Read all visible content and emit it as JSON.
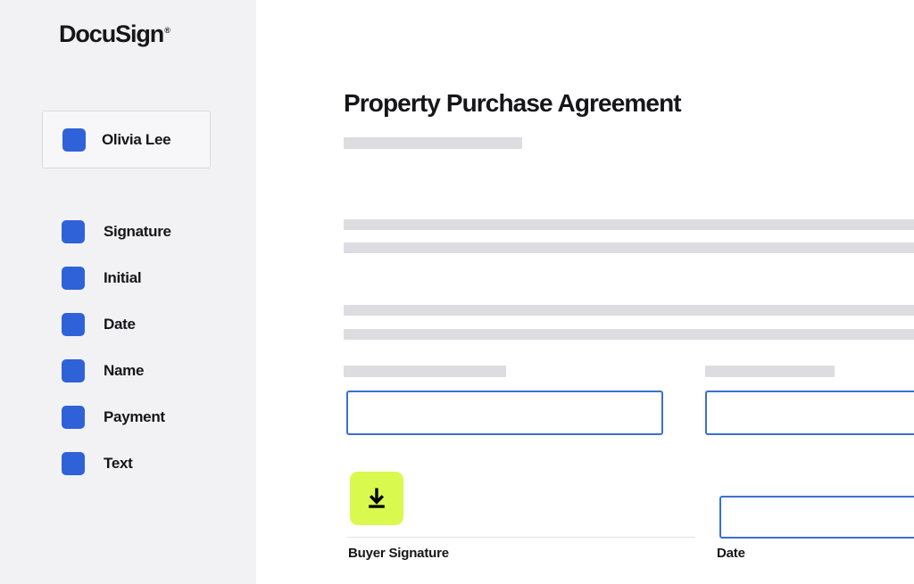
{
  "app": {
    "brand_name": "DocuSign",
    "brand_trademark": "®"
  },
  "sidebar": {
    "user": {
      "name": "Olivia Lee",
      "swatch_color": "#2f62d8"
    },
    "field_items": [
      {
        "label": "Signature",
        "icon": "blue-square-icon"
      },
      {
        "label": "Initial",
        "icon": "blue-square-icon"
      },
      {
        "label": "Date",
        "icon": "blue-square-icon"
      },
      {
        "label": "Name",
        "icon": "blue-square-icon"
      },
      {
        "label": "Payment",
        "icon": "blue-square-icon"
      },
      {
        "label": "Text",
        "icon": "blue-square-icon"
      }
    ]
  },
  "document": {
    "title": "Property Purchase Agreement",
    "fields": [
      {
        "name": "buyer-name",
        "value": "",
        "placeholder": ""
      },
      {
        "name": "seller-name",
        "value": "",
        "placeholder": ""
      },
      {
        "name": "date",
        "value": "",
        "placeholder": ""
      }
    ],
    "captions": {
      "buyer_signature": "Buyer Signature",
      "date": "Date"
    },
    "signature_button": {
      "icon": "download-arrow-icon",
      "background_color": "#d9f94f"
    }
  },
  "colors": {
    "accent_blue": "#2f62d8",
    "field_border_blue": "#3b6fd4",
    "highlight_lime": "#d9f94f",
    "placeholder_gray": "#dcdce1",
    "sidebar_gray": "#f2f2f5",
    "text_dark": "#16161a"
  }
}
